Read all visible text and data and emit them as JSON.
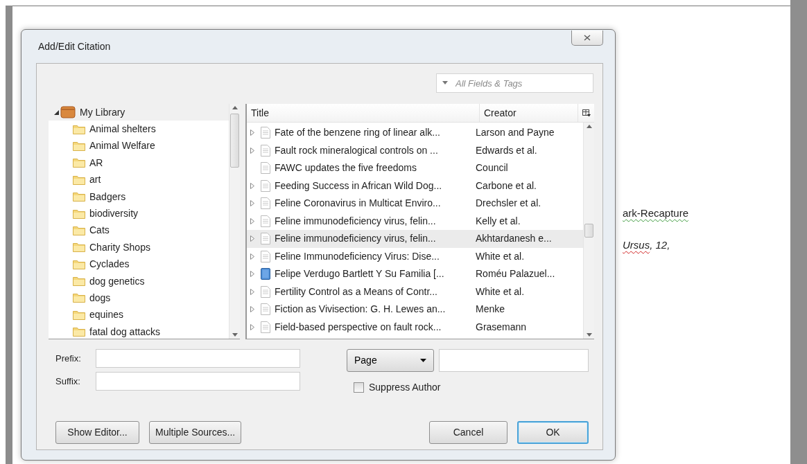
{
  "window": {
    "title": "Add/Edit Citation"
  },
  "search": {
    "placeholder": "All Fields & Tags"
  },
  "library": {
    "label": "My Library",
    "expanded": true,
    "children": [
      {
        "label": "Animal shelters"
      },
      {
        "label": "Animal Welfare"
      },
      {
        "label": "AR"
      },
      {
        "label": "art"
      },
      {
        "label": "Badgers"
      },
      {
        "label": "biodiversity"
      },
      {
        "label": "Cats"
      },
      {
        "label": "Charity Shops"
      },
      {
        "label": "Cyclades"
      },
      {
        "label": "dog genetics"
      },
      {
        "label": "dogs"
      },
      {
        "label": "equines"
      },
      {
        "label": "fatal dog attacks"
      }
    ]
  },
  "items": {
    "columns": [
      "Title",
      "Creator"
    ],
    "rows": [
      {
        "title": "Fate of the benzene ring of linear alk...",
        "creator": "Larson and Payne",
        "kind": "document",
        "expandable": true,
        "selected": false
      },
      {
        "title": "Fault rock mineralogical controls on ...",
        "creator": "Edwards et al.",
        "kind": "document",
        "expandable": true,
        "selected": false
      },
      {
        "title": "FAWC updates the five freedoms",
        "creator": "Council",
        "kind": "document",
        "expandable": false,
        "selected": false
      },
      {
        "title": "Feeding Success in African Wild Dog...",
        "creator": "Carbone et al.",
        "kind": "document",
        "expandable": true,
        "selected": false
      },
      {
        "title": "Feline Coronavirus in Multicat Enviro...",
        "creator": "Drechsler et al.",
        "kind": "document",
        "expandable": true,
        "selected": false
      },
      {
        "title": "Feline immunodeficiency virus, felin...",
        "creator": "Kelly et al.",
        "kind": "document",
        "expandable": true,
        "selected": false
      },
      {
        "title": "Feline immunodeficiency virus, felin...",
        "creator": "Akhtardanesh e...",
        "kind": "document",
        "expandable": true,
        "selected": true
      },
      {
        "title": "Feline Immunodeficiency Virus: Dise...",
        "creator": "White et al.",
        "kind": "document",
        "expandable": true,
        "selected": false
      },
      {
        "title": "Felipe Verdugo Bartlett Y Su Familia [...",
        "creator": "Roméu Palazuel...",
        "kind": "book",
        "expandable": true,
        "selected": false
      },
      {
        "title": "Fertility Control as a Means of Contr...",
        "creator": "White et al.",
        "kind": "document",
        "expandable": true,
        "selected": false
      },
      {
        "title": "Fiction as Vivisection: G. H. Lewes an...",
        "creator": "Menke",
        "kind": "document",
        "expandable": true,
        "selected": false
      },
      {
        "title": "Field-based perspective on fault rock...",
        "creator": "Grasemann",
        "kind": "document",
        "expandable": true,
        "selected": false
      }
    ]
  },
  "prefix": {
    "label": "Prefix:"
  },
  "suffix": {
    "label": "Suffix:"
  },
  "locator": {
    "value": "Page"
  },
  "suppress_author": {
    "label": "Suppress Author",
    "checked": false
  },
  "buttons": [
    {
      "label": "Show Editor...",
      "default": false
    },
    {
      "label": "Multiple Sources...",
      "default": false
    },
    {
      "label": "Cancel",
      "default": false
    },
    {
      "label": "OK",
      "default": true
    }
  ],
  "document": {
    "lines": [
      {
        "italic": false,
        "segments": [
          {
            "text": "ark-Recapture",
            "kind": "grammar"
          }
        ]
      },
      {
        "italic": true,
        "segments": [
          {
            "text": "Ursus",
            "kind": "spelling"
          },
          {
            "text": ", 12,",
            "kind": "plain"
          }
        ]
      }
    ]
  }
}
